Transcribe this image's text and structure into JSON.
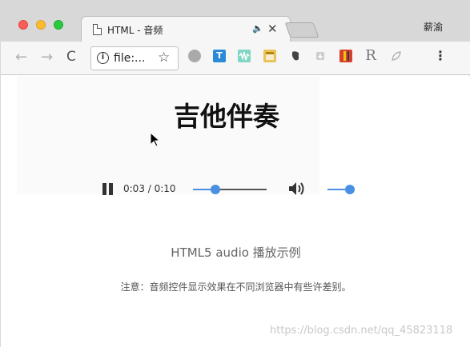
{
  "browser": {
    "tab_title": "HTML - 音频",
    "profile_name": "薪渝",
    "url": "file:...",
    "info_symbol": "i",
    "back_glyph": "←",
    "forward_glyph": "→",
    "reload_glyph": "C",
    "star_glyph": "☆",
    "close_glyph": "✕",
    "speaker_glyph": "🔈",
    "menu_glyph": "⋮",
    "extensions": [
      "globe-icon",
      "translate-icon",
      "waveform-icon",
      "notes-icon",
      "evernote-icon",
      "download-icon",
      "bookmark-icon",
      "readability-icon",
      "leaf-icon"
    ],
    "ext_labels": {
      "t": "T",
      "r": "R"
    }
  },
  "page": {
    "title": "吉他伴奏",
    "subtitle": "HTML5 audio 播放示例",
    "note": "注意：音频控件显示效果在不同浏览器中有些许差别。",
    "watermark": "https://blog.csdn.net/qq_45823118"
  },
  "player": {
    "time": "0:03 / 0:10",
    "progress_fraction": 0.3,
    "volume_fraction": 1.0
  },
  "colors": {
    "accent": "#4a90e2",
    "close_red": "#fd5f57",
    "minimize_yellow": "#fdbc2e",
    "zoom_green": "#28c93f"
  }
}
